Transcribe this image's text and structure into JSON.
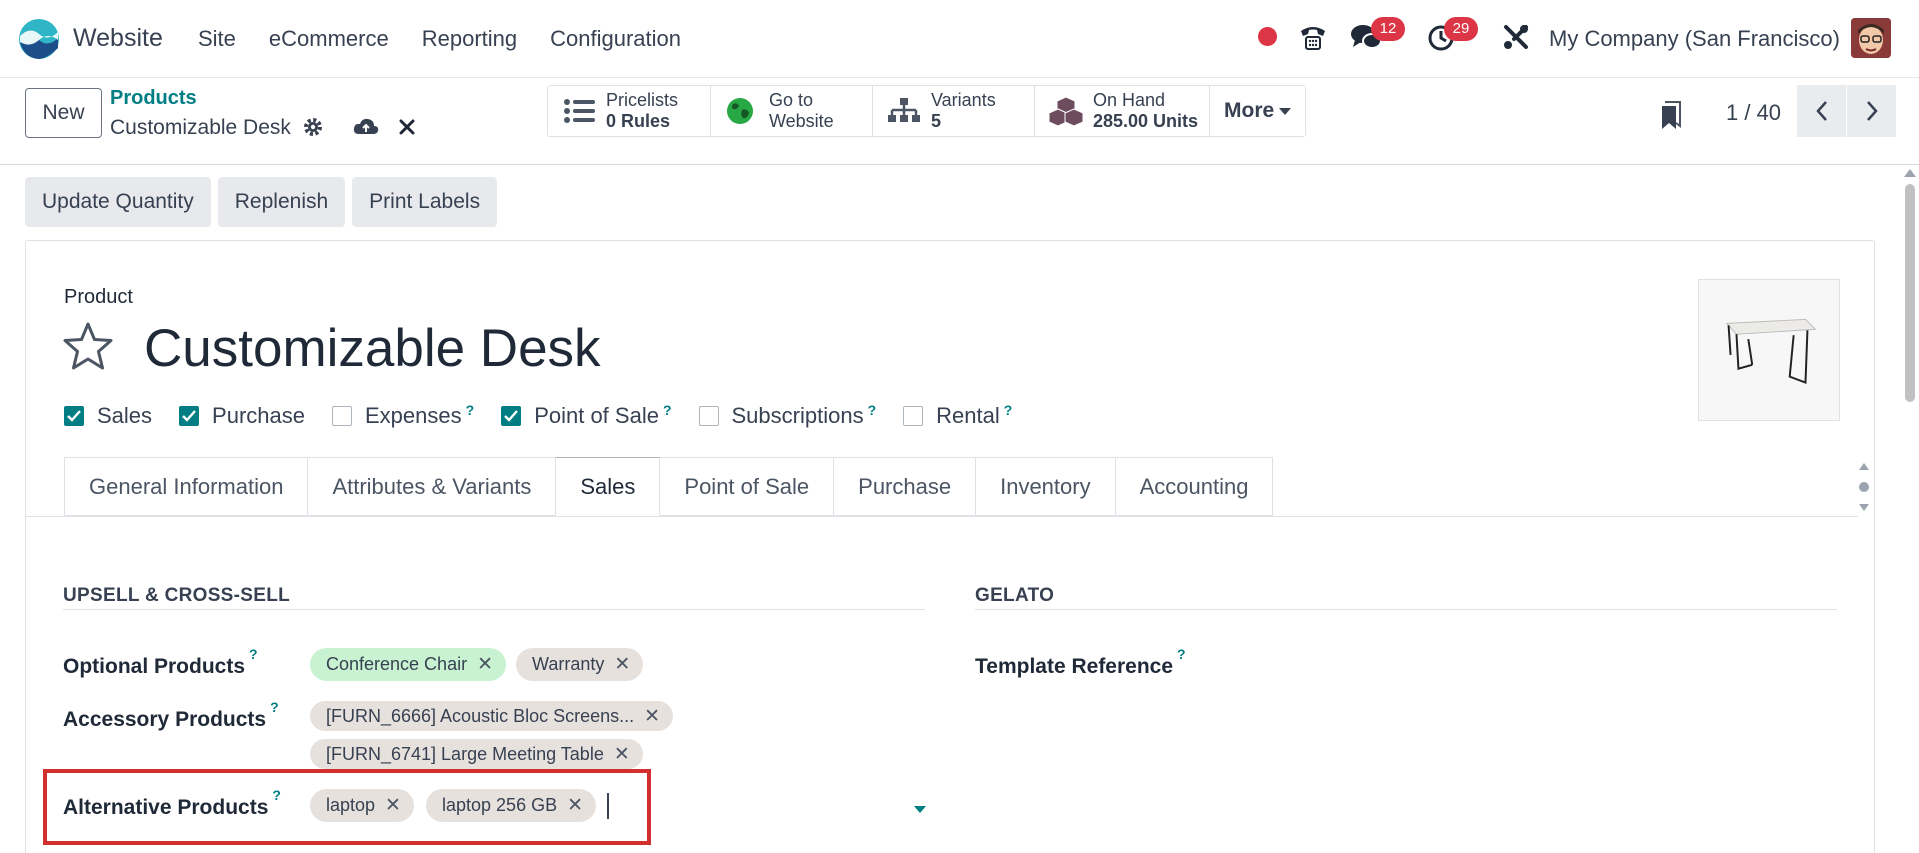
{
  "navbar": {
    "app_name": "Website",
    "menu": [
      "Site",
      "eCommerce",
      "Reporting",
      "Configuration"
    ],
    "chat_badge": "12",
    "activity_badge": "29",
    "company": "My Company (San Francisco)"
  },
  "control": {
    "new_label": "New",
    "breadcrumb_parent": "Products",
    "breadcrumb_current": "Customizable Desk",
    "smart_buttons": [
      {
        "label": "Pricelists",
        "value": "0  Rules",
        "icon": "list-icon"
      },
      {
        "label": "Go to",
        "value": "Website",
        "icon": "globe-icon"
      },
      {
        "label": "Variants",
        "value": "5",
        "icon": "sitemap-icon"
      },
      {
        "label": "On Hand",
        "value": "285.00 Units",
        "icon": "cubes-icon"
      }
    ],
    "more_label": "More",
    "pager": "1 / 40"
  },
  "actions": [
    "Update Quantity",
    "Replenish",
    "Print Labels"
  ],
  "form": {
    "product_label": "Product",
    "title": "Customizable Desk",
    "checkboxes": [
      {
        "label": "Sales",
        "checked": true,
        "help": ""
      },
      {
        "label": "Purchase",
        "checked": true,
        "help": ""
      },
      {
        "label": "Expenses",
        "checked": false,
        "help": "?"
      },
      {
        "label": "Point of Sale",
        "checked": true,
        "help": "?"
      },
      {
        "label": "Subscriptions",
        "checked": false,
        "help": "?"
      },
      {
        "label": "Rental",
        "checked": false,
        "help": "?"
      }
    ],
    "tabs": [
      "General Information",
      "Attributes & Variants",
      "Sales",
      "Point of Sale",
      "Purchase",
      "Inventory",
      "Accounting"
    ],
    "active_tab": "Sales",
    "section_upsell": "UPSELL & CROSS-SELL",
    "section_gelato": "GELATO",
    "fields": {
      "optional_label": "Optional Products",
      "optional_tags": [
        "Conference Chair",
        "Warranty"
      ],
      "accessory_label": "Accessory Products",
      "accessory_tags": [
        "[FURN_6666] Acoustic Bloc Screens...",
        "[FURN_6741] Large Meeting Table"
      ],
      "alternative_label": "Alternative Products",
      "alternative_tags": [
        "laptop",
        "laptop 256 GB"
      ],
      "template_label": "Template Reference",
      "help": "?"
    }
  },
  "colors": {
    "accent": "#017e84",
    "danger": "#dc3545",
    "highlight": "#d32f2f"
  }
}
